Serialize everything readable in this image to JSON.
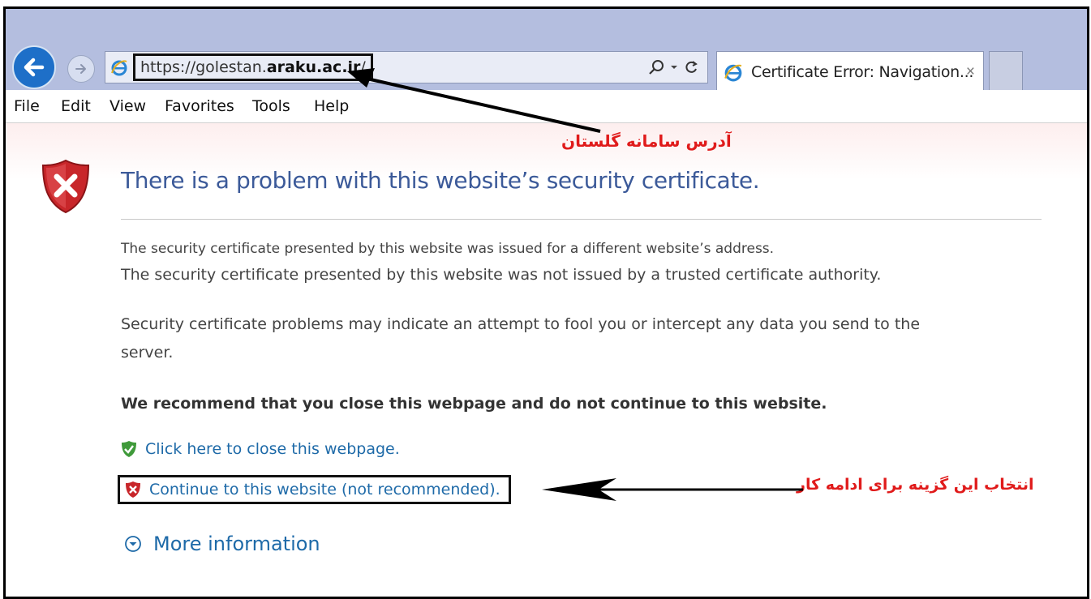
{
  "browser": {
    "address_url_host_prefix": "https://golestan.",
    "address_url_host_bold": "araku.ac.ir",
    "address_url_suffix": "/",
    "tab_title": "Certificate Error: Navigation...",
    "tab_close": "×",
    "icons": [
      "back-arrow-icon",
      "forward-arrow-icon",
      "ie-logo-icon",
      "search-icon",
      "dropdown-icon",
      "refresh-icon",
      "close-icon"
    ]
  },
  "menu": {
    "items": [
      {
        "label": "File"
      },
      {
        "label": "Edit"
      },
      {
        "label": "View"
      },
      {
        "label": "Favorites"
      },
      {
        "label": "Tools"
      },
      {
        "label": "Help"
      }
    ]
  },
  "page": {
    "heading": "There is a problem with this website’s security certificate.",
    "line1": "The security certificate presented by this website was issued for a different website’s address.",
    "line2": "The security certificate presented by this website was not issued by a trusted certificate authority.",
    "line3a": "Security certificate problems may indicate an attempt to fool you or intercept any data you send to the",
    "line3b": "server.",
    "recommend": "We recommend that you close this webpage and do not continue to this website.",
    "close_link": "Click here to close this webpage.",
    "continue_link": "Continue to this website (not recommended).",
    "more_info": "More information",
    "icons": [
      "error-shield-icon",
      "green-shield-icon",
      "red-shield-icon",
      "expand-icon"
    ]
  },
  "annotations": {
    "address_note": "آدرس سامانه گلستان",
    "continue_note": "انتخاب این گزینه برای ادامه کار",
    "colors": {
      "annotation": "#e01b1b",
      "link": "#1e6aa8",
      "heading": "#3c5a99"
    }
  }
}
